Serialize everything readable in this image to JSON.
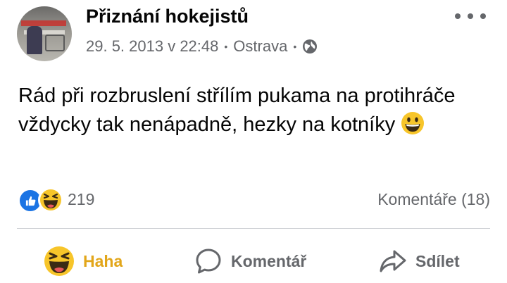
{
  "post": {
    "author": "Přiznání hokejistů",
    "date": "29. 5. 2013 v 22:48",
    "location": "Ostrava",
    "text": "Rád při rozbruslení střílím pukama na protihráče vždycky tak nenápadně, hezky na kotníky",
    "audience_icon": "globe-icon",
    "menu_icon": "more-horizontal-icon"
  },
  "stats": {
    "reaction_count": "219",
    "reaction_types": [
      "like",
      "haha"
    ],
    "comments": "Komentáře (18)"
  },
  "actions": {
    "reaction_label": "Haha",
    "comment_label": "Komentář",
    "share_label": "Sdílet"
  },
  "colors": {
    "text": "#050505",
    "secondary": "#65676b",
    "like_blue": "#1b74e4",
    "haha_gold": "#e2a61a",
    "divider": "#ced0d4"
  }
}
